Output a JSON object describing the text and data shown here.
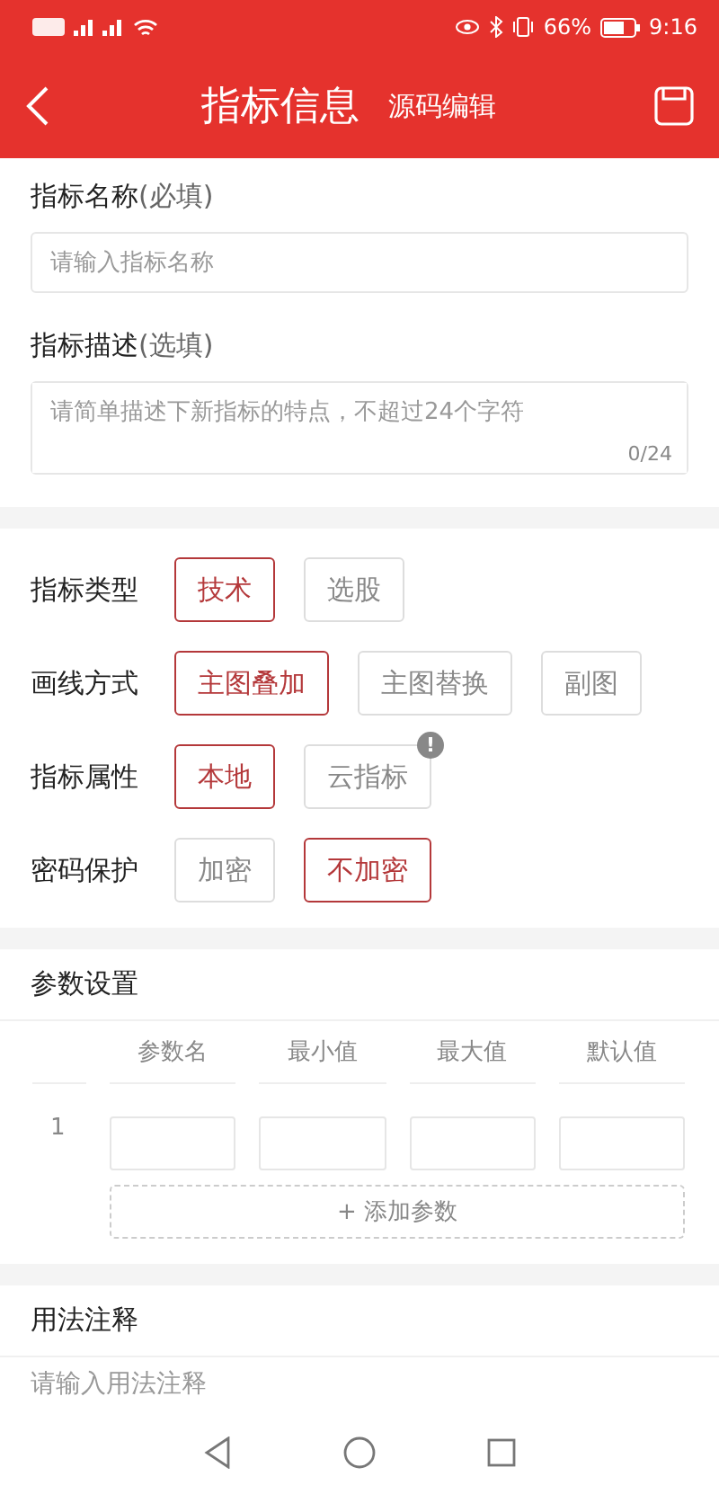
{
  "status_bar": {
    "battery": "66%",
    "time": "9:16"
  },
  "header": {
    "title": "指标信息",
    "subtitle": "源码编辑"
  },
  "basic": [
    {
      "label": "指标名称",
      "hint": "(必填)",
      "placeholder": "请输入指标名称",
      "kind": "input"
    },
    {
      "label": "指标描述",
      "hint": "(选填)",
      "placeholder": "请简单描述下新指标的特点，不超过24个字符",
      "counter": "0/24",
      "kind": "textarea"
    }
  ],
  "options": [
    {
      "label": "指标类型",
      "choices": [
        {
          "label": "技术",
          "selected": true
        },
        {
          "label": "选股",
          "selected": false
        }
      ]
    },
    {
      "label": "画线方式",
      "choices": [
        {
          "label": "主图叠加",
          "selected": true
        },
        {
          "label": "主图替换",
          "selected": false
        },
        {
          "label": "副图",
          "selected": false
        }
      ]
    },
    {
      "label": "指标属性",
      "choices": [
        {
          "label": "本地",
          "selected": true
        },
        {
          "label": "云指标",
          "selected": false,
          "badge": "!"
        }
      ]
    },
    {
      "label": "密码保护",
      "choices": [
        {
          "label": "加密",
          "selected": false
        },
        {
          "label": "不加密",
          "selected": true
        }
      ]
    }
  ],
  "params": {
    "title": "参数设置",
    "columns": [
      "参数名",
      "最小值",
      "最大值",
      "默认值"
    ],
    "rows": [
      {
        "index": "1"
      }
    ],
    "add_button": "+ 添加参数"
  },
  "usage": {
    "title": "用法注释",
    "placeholder": "请输入用法注释"
  }
}
